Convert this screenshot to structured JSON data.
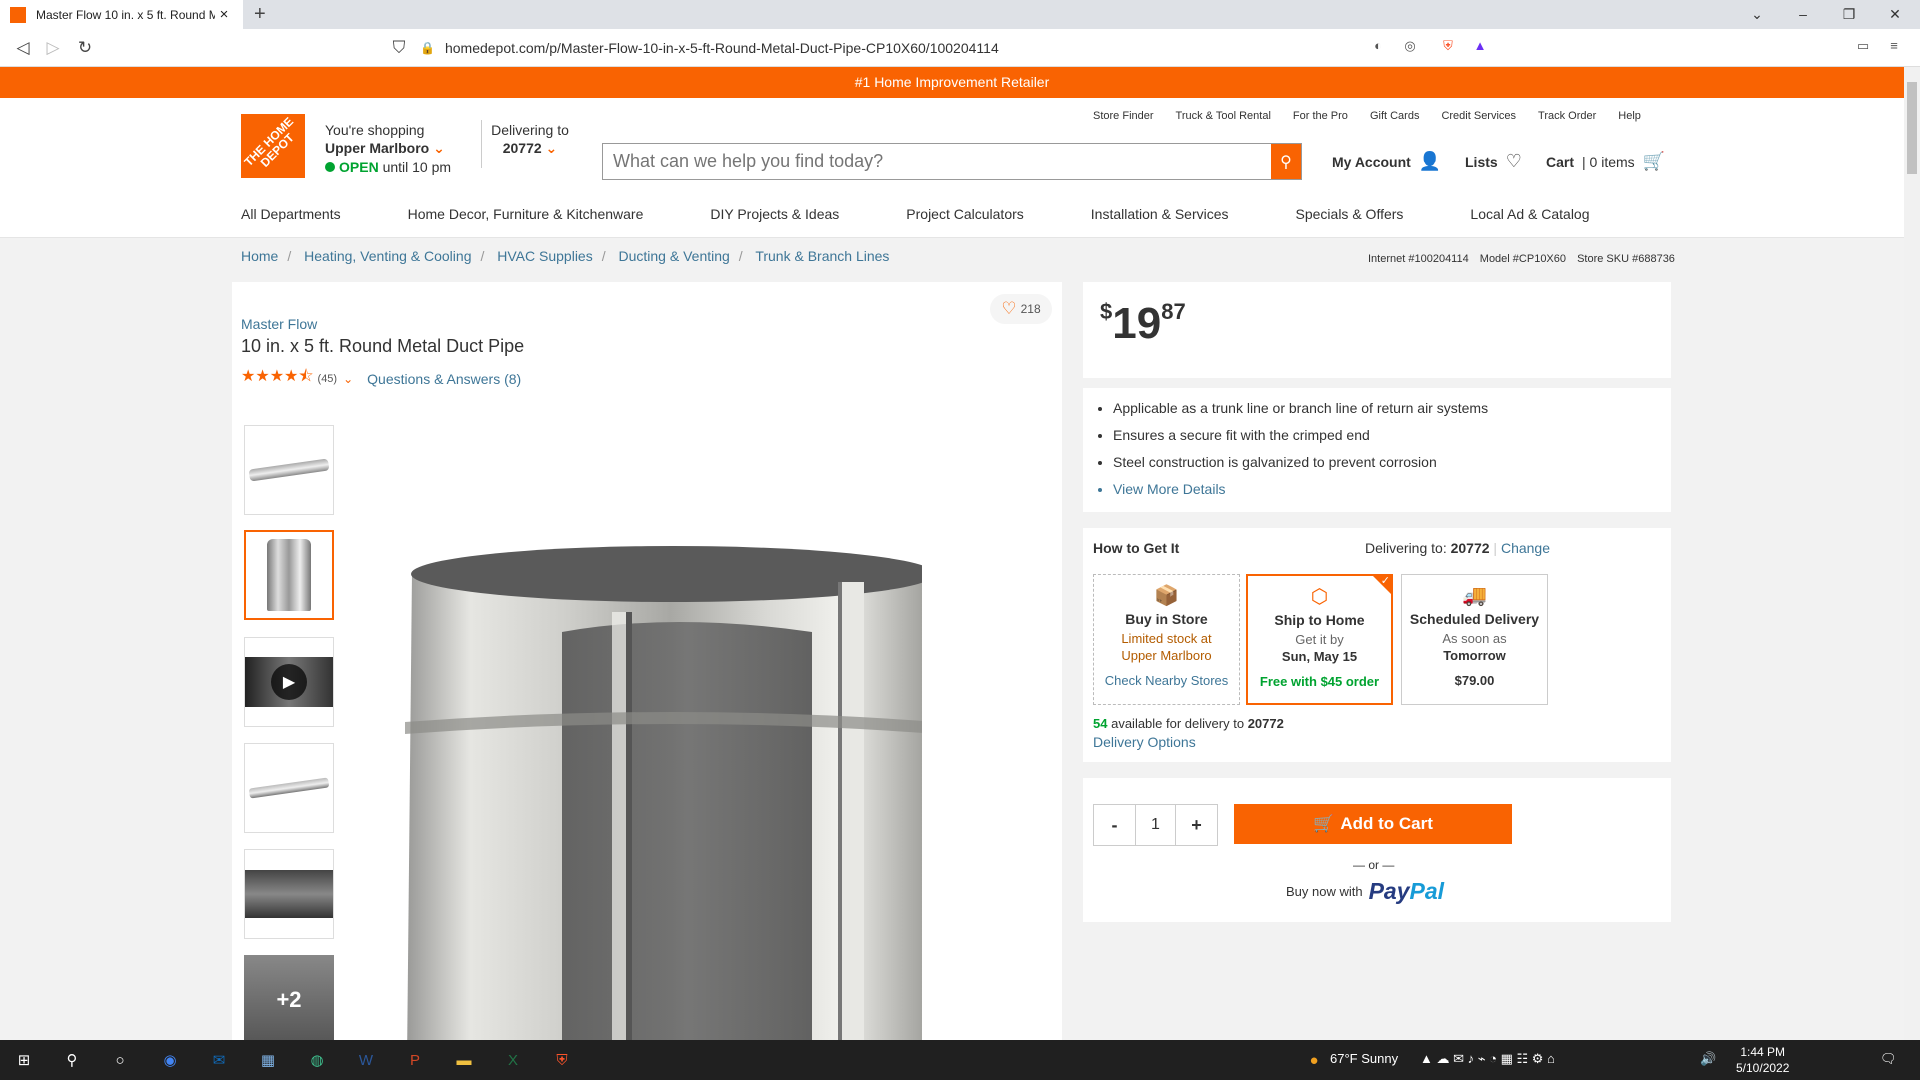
{
  "browser": {
    "tab_title": "Master Flow 10 in. x 5 ft. Round M",
    "url": "homedepot.com/p/Master-Flow-10-in-x-5-ft-Round-Metal-Duct-Pipe-CP10X60/100204114"
  },
  "banner": "#1 Home Improvement Retailer",
  "header": {
    "logo_text": "THE HOME DEPOT",
    "shopping_label": "You're shopping",
    "store_name": "Upper Marlboro",
    "open_label": "OPEN",
    "open_hours": "until 10 pm",
    "delivering_label": "Delivering to",
    "zip": "20772",
    "search_placeholder": "What can we help you find today?",
    "util_links": [
      "Store Finder",
      "Truck & Tool Rental",
      "For the Pro",
      "Gift Cards",
      "Credit Services",
      "Track Order",
      "Help"
    ],
    "account_label": "My Account",
    "lists_label": "Lists",
    "cart_label": "Cart",
    "cart_items": "| 0 items"
  },
  "nav": [
    "All Departments",
    "Home Decor, Furniture & Kitchenware",
    "DIY Projects & Ideas",
    "Project Calculators",
    "Installation & Services",
    "Specials & Offers",
    "Local Ad & Catalog"
  ],
  "breadcrumbs": [
    "Home",
    "Heating, Venting & Cooling",
    "HVAC Supplies",
    "Ducting & Venting",
    "Trunk & Branch Lines"
  ],
  "identifiers": {
    "internet": "Internet #100204114",
    "model": "Model #CP10X60",
    "sku": "Store SKU #688736"
  },
  "product": {
    "brand": "Master Flow",
    "title": "10 in. x 5 ft. Round Metal Duct Pipe",
    "rating_stars": 4.5,
    "review_count": "(45)",
    "qa_label": "Questions & Answers (8)",
    "favorites": "218",
    "more_images": "+2"
  },
  "price": {
    "currency": "$",
    "dollars": "19",
    "cents": "87"
  },
  "highlights": [
    "Applicable as a trunk line or branch line of return air systems",
    "Ensures a secure fit with the crimped end",
    "Steel construction is galvanized to prevent corrosion"
  ],
  "view_more": "View More Details",
  "fulfillment": {
    "title": "How to Get It",
    "delivering_to_label": "Delivering to:",
    "zip": "20772",
    "change_label": "Change",
    "store": {
      "title": "Buy in Store",
      "line1": "Limited stock at",
      "line2": "Upper Marlboro",
      "link": "Check Nearby Stores"
    },
    "ship": {
      "title": "Ship to Home",
      "line1": "Get it by",
      "line2": "Sun, May 15",
      "bottom": "Free with $45 order"
    },
    "scheduled": {
      "title": "Scheduled Delivery",
      "line1": "As soon as",
      "line2": "Tomorrow",
      "bottom": "$79.00"
    },
    "available_count": "54",
    "available_text": "available for delivery to",
    "available_zip": "20772",
    "delivery_options": "Delivery Options"
  },
  "purchase": {
    "minus": "-",
    "qty": "1",
    "plus": "+",
    "add_to_cart": "Add to Cart",
    "or": "— or —",
    "buy_now_with": "Buy now with",
    "paypal_a": "Pay",
    "paypal_b": "Pal"
  },
  "taskbar": {
    "weather": "67°F  Sunny",
    "time": "1:44 PM",
    "date": "5/10/2022"
  },
  "colors": {
    "brand": "#f96302",
    "link": "#3e7697",
    "success": "#00a330"
  }
}
